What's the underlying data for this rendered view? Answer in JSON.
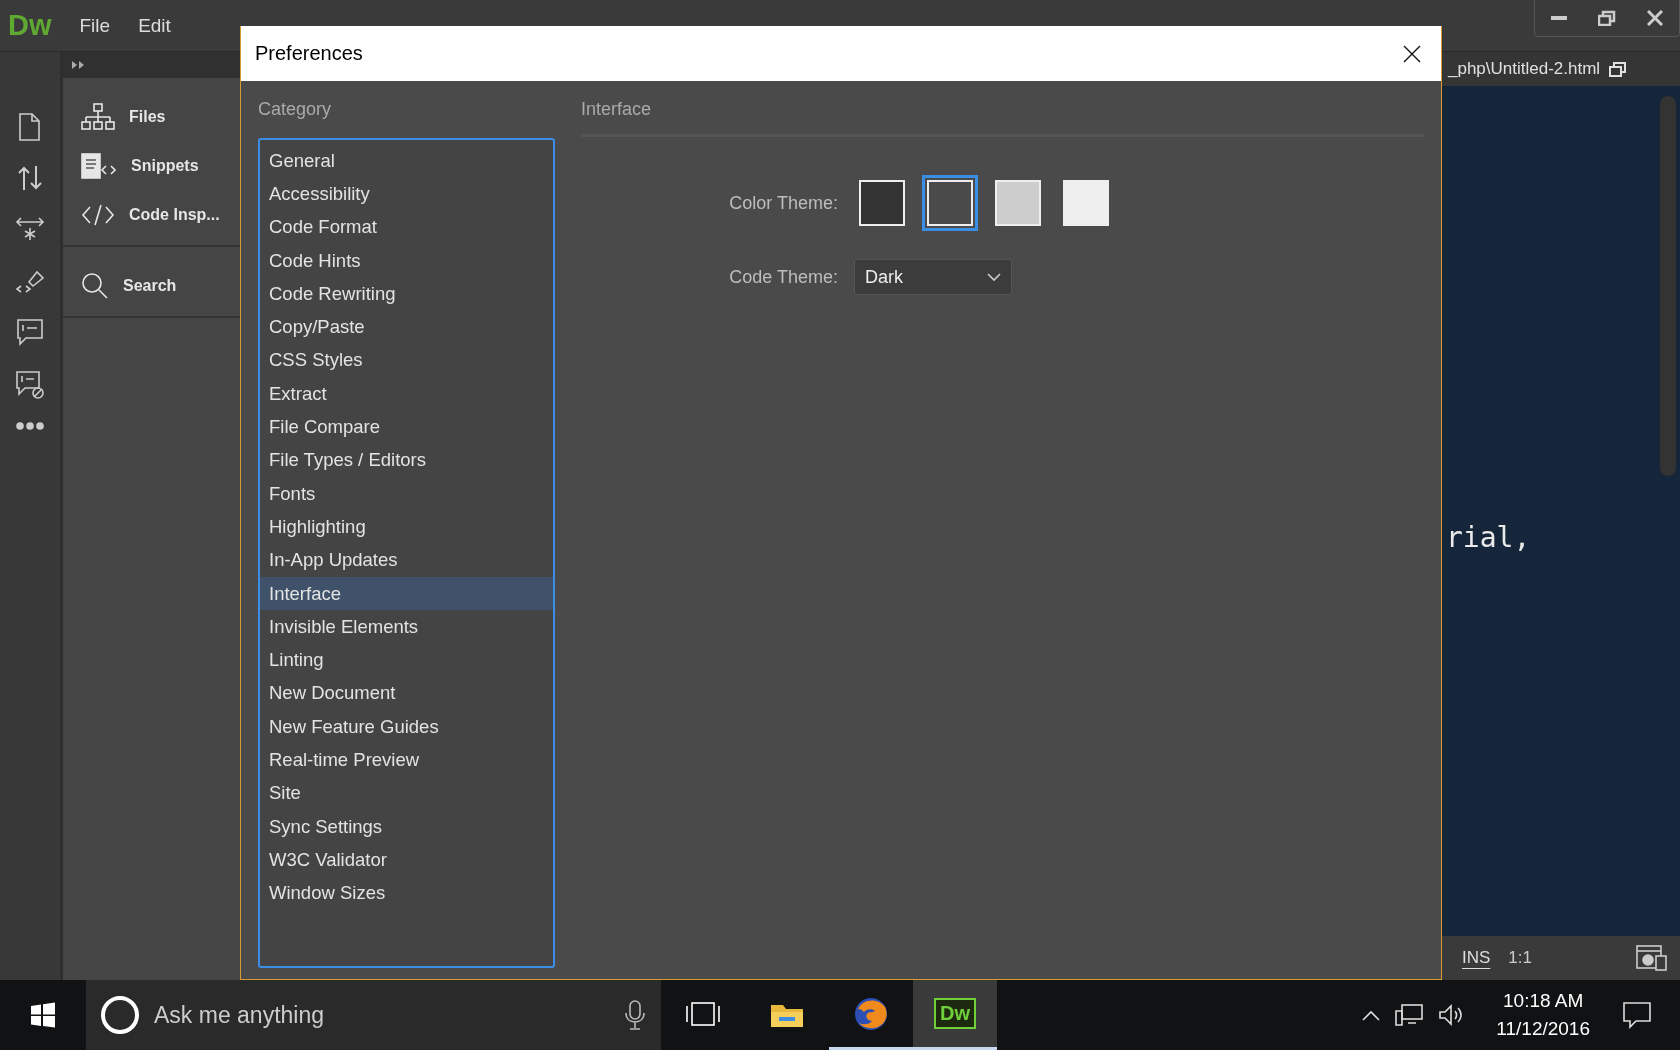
{
  "app": {
    "logo": "Dw",
    "menu": [
      "File",
      "Edit"
    ]
  },
  "side_panel": {
    "items": [
      {
        "kind": "files",
        "label": "Files"
      },
      {
        "kind": "snippets",
        "label": "Snippets"
      },
      {
        "kind": "code",
        "label": "Code Insp..."
      },
      {
        "kind": "search",
        "label": "Search"
      }
    ]
  },
  "editor": {
    "path": "_php\\Untitled-2.html",
    "code_fragment": "rial,",
    "status": {
      "mode": "INS",
      "position": "1:1"
    }
  },
  "dialog": {
    "title": "Preferences",
    "category_heading": "Category",
    "categories": [
      {
        "label": "General",
        "selected": false
      },
      {
        "label": "Accessibility",
        "selected": false
      },
      {
        "label": "Code Format",
        "selected": false
      },
      {
        "label": "Code Hints",
        "selected": false
      },
      {
        "label": "Code Rewriting",
        "selected": false
      },
      {
        "label": "Copy/Paste",
        "selected": false
      },
      {
        "label": "CSS Styles",
        "selected": false
      },
      {
        "label": "Extract",
        "selected": false
      },
      {
        "label": "File Compare",
        "selected": false
      },
      {
        "label": "File Types / Editors",
        "selected": false
      },
      {
        "label": "Fonts",
        "selected": false
      },
      {
        "label": "Highlighting",
        "selected": false
      },
      {
        "label": "In-App Updates",
        "selected": false
      },
      {
        "label": "Interface",
        "selected": true
      },
      {
        "label": "Invisible Elements",
        "selected": false
      },
      {
        "label": "Linting",
        "selected": false
      },
      {
        "label": "New Document",
        "selected": false
      },
      {
        "label": "New Feature Guides",
        "selected": false
      },
      {
        "label": "Real-time Preview",
        "selected": false
      },
      {
        "label": "Site",
        "selected": false
      },
      {
        "label": "Sync Settings",
        "selected": false
      },
      {
        "label": "W3C Validator",
        "selected": false
      },
      {
        "label": "Window Sizes",
        "selected": false
      }
    ],
    "section_title": "Interface",
    "color_theme": {
      "label": "Color Theme:",
      "swatches": [
        {
          "color": "#333333",
          "selected": false
        },
        {
          "color": "#4a4a4a",
          "selected": true
        },
        {
          "color": "#cdcdcd",
          "selected": false
        },
        {
          "color": "#efefef",
          "selected": false
        }
      ]
    },
    "code_theme": {
      "label": "Code Theme:",
      "value": "Dark"
    }
  },
  "taskbar": {
    "search_placeholder": "Ask me anything",
    "pinned": [
      {
        "kind": "task-view",
        "running": false,
        "selected": false
      },
      {
        "kind": "folder",
        "running": false,
        "selected": false
      },
      {
        "kind": "browser",
        "running": true,
        "selected": false
      },
      {
        "kind": "app",
        "label": "Dw",
        "running": true,
        "selected": true
      }
    ],
    "time": "10:18 AM",
    "date": "11/12/2016"
  }
}
